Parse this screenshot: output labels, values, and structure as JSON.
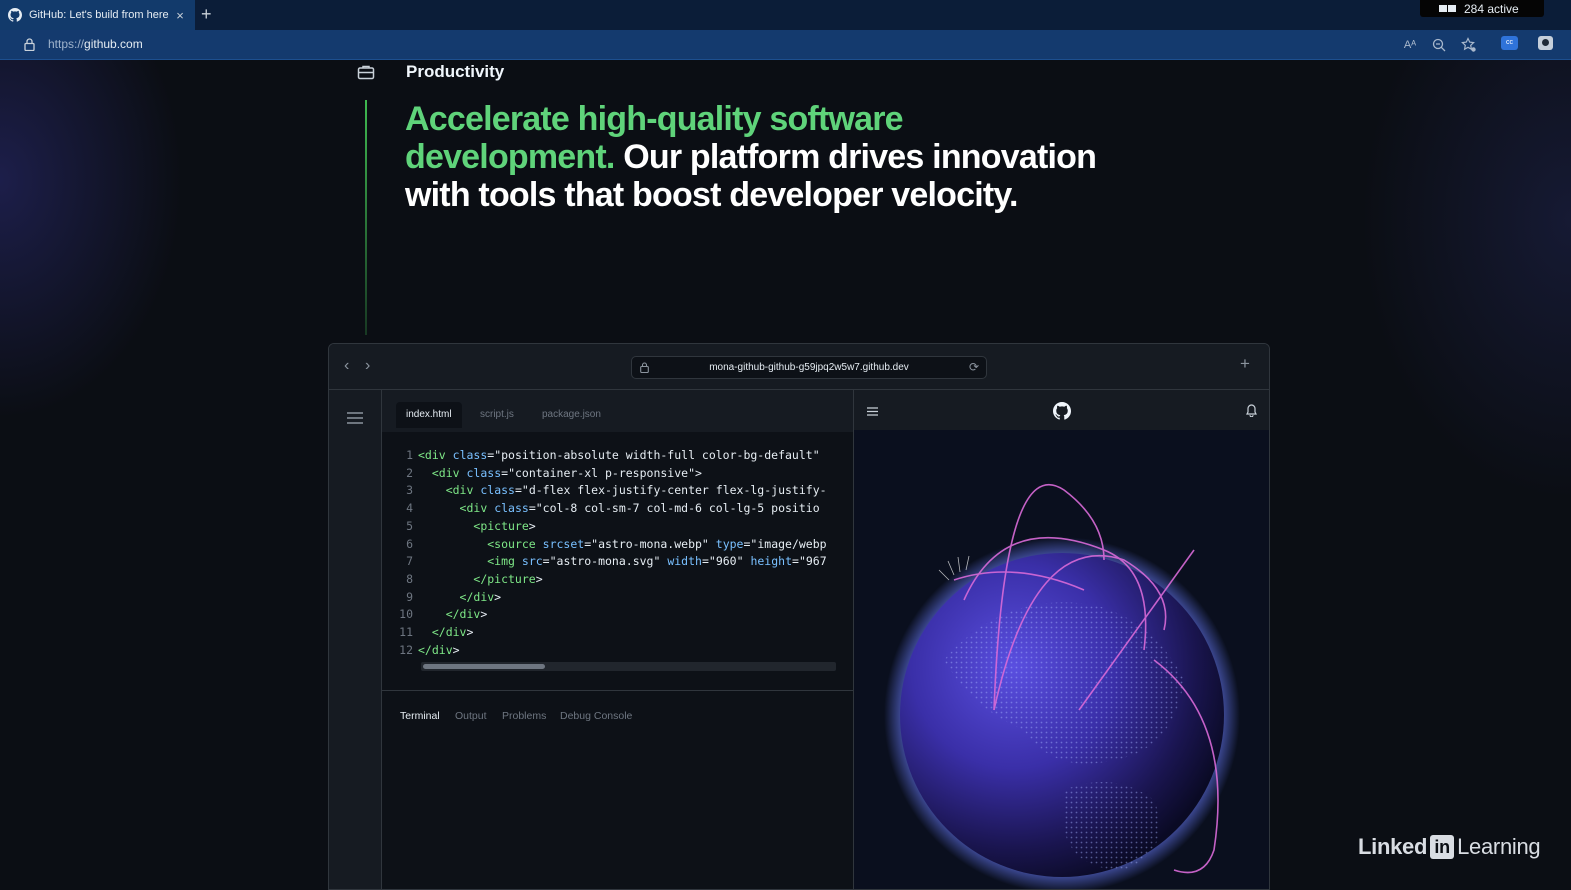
{
  "browser": {
    "tab_title": "GitHub: Let's build from here",
    "tab_close": "×",
    "new_tab": "+",
    "url_protocol": "https://",
    "url_host": "github.com",
    "active_count": "284 active"
  },
  "hero": {
    "section_label": "Productivity",
    "headline_highlight": "Accelerate high-quality software development.",
    "headline_rest": " Our platform drives innovation with tools that boost developer velocity.",
    "accent_color": "#5fd37a"
  },
  "editor": {
    "address": "mona-github-github-g59jpq2w5w7.github.dev",
    "file_tabs": [
      "index.html",
      "script.js",
      "package.json"
    ],
    "active_file": "index.html",
    "code_lines": [
      {
        "n": "1",
        "indent": "",
        "html": "<span class=\"t\">&lt;div</span> <span class=\"a\">class</span>=<span class=\"s\">\"position-absolute width-full color-bg-default\"</span>"
      },
      {
        "n": "2",
        "indent": "  ",
        "html": "<span class=\"t\">&lt;div</span> <span class=\"a\">class</span>=<span class=\"s\">\"container-xl p-responsive\"</span><span class=\"p\">&gt;</span>"
      },
      {
        "n": "3",
        "indent": "    ",
        "html": "<span class=\"t\">&lt;div</span> <span class=\"a\">class</span>=<span class=\"s\">\"d-flex flex-justify-center flex-lg-justify-</span>"
      },
      {
        "n": "4",
        "indent": "      ",
        "html": "<span class=\"t\">&lt;div</span> <span class=\"a\">class</span>=<span class=\"s\">\"col-8 col-sm-7 col-md-6 col-lg-5 positio</span>"
      },
      {
        "n": "5",
        "indent": "        ",
        "html": "<span class=\"t\">&lt;picture</span><span class=\"p\">&gt;</span>"
      },
      {
        "n": "6",
        "indent": "          ",
        "html": "<span class=\"t\">&lt;source</span> <span class=\"a\">srcset</span>=<span class=\"s\">\"astro-mona.webp\"</span> <span class=\"a\">type</span>=<span class=\"s\">\"image/webp</span>"
      },
      {
        "n": "7",
        "indent": "          ",
        "html": "<span class=\"t\">&lt;img</span> <span class=\"a\">src</span>=<span class=\"s\">\"astro-mona.svg\"</span> <span class=\"a\">width</span>=<span class=\"s\">\"960\"</span> <span class=\"a\">height</span>=<span class=\"s\">\"967</span>"
      },
      {
        "n": "8",
        "indent": "        ",
        "html": "<span class=\"t\">&lt;/picture</span><span class=\"p\">&gt;</span>"
      },
      {
        "n": "9",
        "indent": "      ",
        "html": "<span class=\"t\">&lt;/div</span><span class=\"p\">&gt;</span>"
      },
      {
        "n": "10",
        "indent": "    ",
        "html": "<span class=\"t\">&lt;/div</span><span class=\"p\">&gt;</span>"
      },
      {
        "n": "11",
        "indent": "  ",
        "html": "<span class=\"t\">&lt;/div</span><span class=\"p\">&gt;</span>"
      },
      {
        "n": "12",
        "indent": "",
        "html": "<span class=\"t\">&lt;/div</span><span class=\"p\">&gt;</span>"
      }
    ],
    "terminal_tabs": [
      "Terminal",
      "Output",
      "Problems",
      "Debug Console"
    ],
    "active_terminal_tab": "Terminal"
  },
  "watermark": {
    "brand_a": "Linked",
    "brand_in": "in",
    "brand_b": "Learning"
  }
}
